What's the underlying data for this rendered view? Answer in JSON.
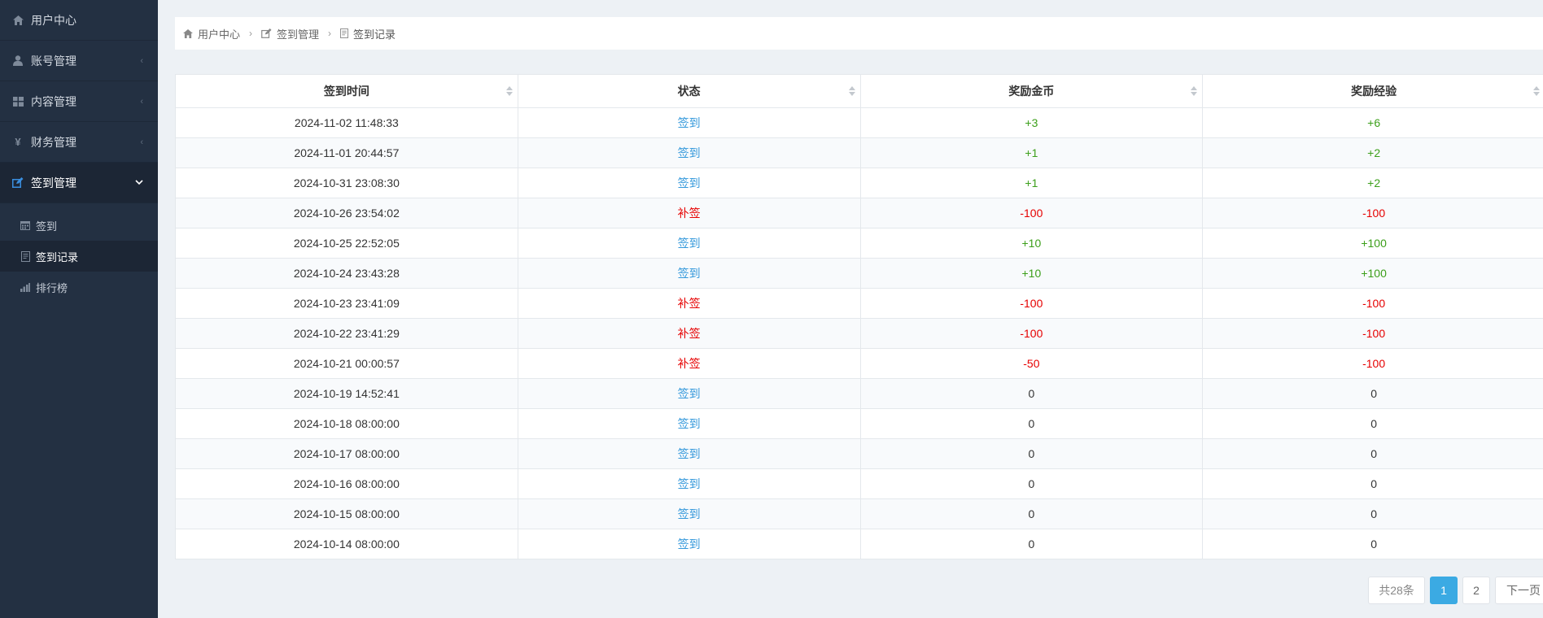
{
  "sidebar": {
    "items": [
      {
        "label": "用户中心",
        "icon": "home-icon"
      },
      {
        "label": "账号管理",
        "icon": "user-icon"
      },
      {
        "label": "内容管理",
        "icon": "grid-icon"
      },
      {
        "label": "财务管理",
        "icon": "yen-icon"
      },
      {
        "label": "签到管理",
        "icon": "edit-icon"
      }
    ],
    "sub_items": [
      {
        "label": "签到",
        "icon": "calendar-icon"
      },
      {
        "label": "签到记录",
        "icon": "document-icon"
      },
      {
        "label": "排行榜",
        "icon": "bar-chart-icon"
      }
    ]
  },
  "breadcrumb": {
    "items": [
      "用户中心",
      "签到管理",
      "签到记录"
    ]
  },
  "table": {
    "headers": [
      "签到时间",
      "状态",
      "奖励金币",
      "奖励经验"
    ],
    "rows": [
      {
        "time": "2024-11-02 11:48:33",
        "status": "签到",
        "coins": "+3",
        "exp": "+6"
      },
      {
        "time": "2024-11-01 20:44:57",
        "status": "签到",
        "coins": "+1",
        "exp": "+2"
      },
      {
        "time": "2024-10-31 23:08:30",
        "status": "签到",
        "coins": "+1",
        "exp": "+2"
      },
      {
        "time": "2024-10-26 23:54:02",
        "status": "补签",
        "coins": "-100",
        "exp": "-100"
      },
      {
        "time": "2024-10-25 22:52:05",
        "status": "签到",
        "coins": "+10",
        "exp": "+100"
      },
      {
        "time": "2024-10-24 23:43:28",
        "status": "签到",
        "coins": "+10",
        "exp": "+100"
      },
      {
        "time": "2024-10-23 23:41:09",
        "status": "补签",
        "coins": "-100",
        "exp": "-100"
      },
      {
        "time": "2024-10-22 23:41:29",
        "status": "补签",
        "coins": "-100",
        "exp": "-100"
      },
      {
        "time": "2024-10-21 00:00:57",
        "status": "补签",
        "coins": "-50",
        "exp": "-100"
      },
      {
        "time": "2024-10-19 14:52:41",
        "status": "签到",
        "coins": "0",
        "exp": "0"
      },
      {
        "time": "2024-10-18 08:00:00",
        "status": "签到",
        "coins": "0",
        "exp": "0"
      },
      {
        "time": "2024-10-17 08:00:00",
        "status": "签到",
        "coins": "0",
        "exp": "0"
      },
      {
        "time": "2024-10-16 08:00:00",
        "status": "签到",
        "coins": "0",
        "exp": "0"
      },
      {
        "time": "2024-10-15 08:00:00",
        "status": "签到",
        "coins": "0",
        "exp": "0"
      },
      {
        "time": "2024-10-14 08:00:00",
        "status": "签到",
        "coins": "0",
        "exp": "0"
      }
    ]
  },
  "pagination": {
    "total_label": "共28条",
    "pages": [
      "1",
      "2"
    ],
    "current": "1",
    "next_label": "下一页"
  },
  "colors": {
    "sidebar_bg": "#233042",
    "sign_status": "#3398db",
    "makeup_status": "#e60000",
    "positive": "#3c9f1a",
    "negative": "#e60000",
    "page_active": "#3baae3"
  }
}
